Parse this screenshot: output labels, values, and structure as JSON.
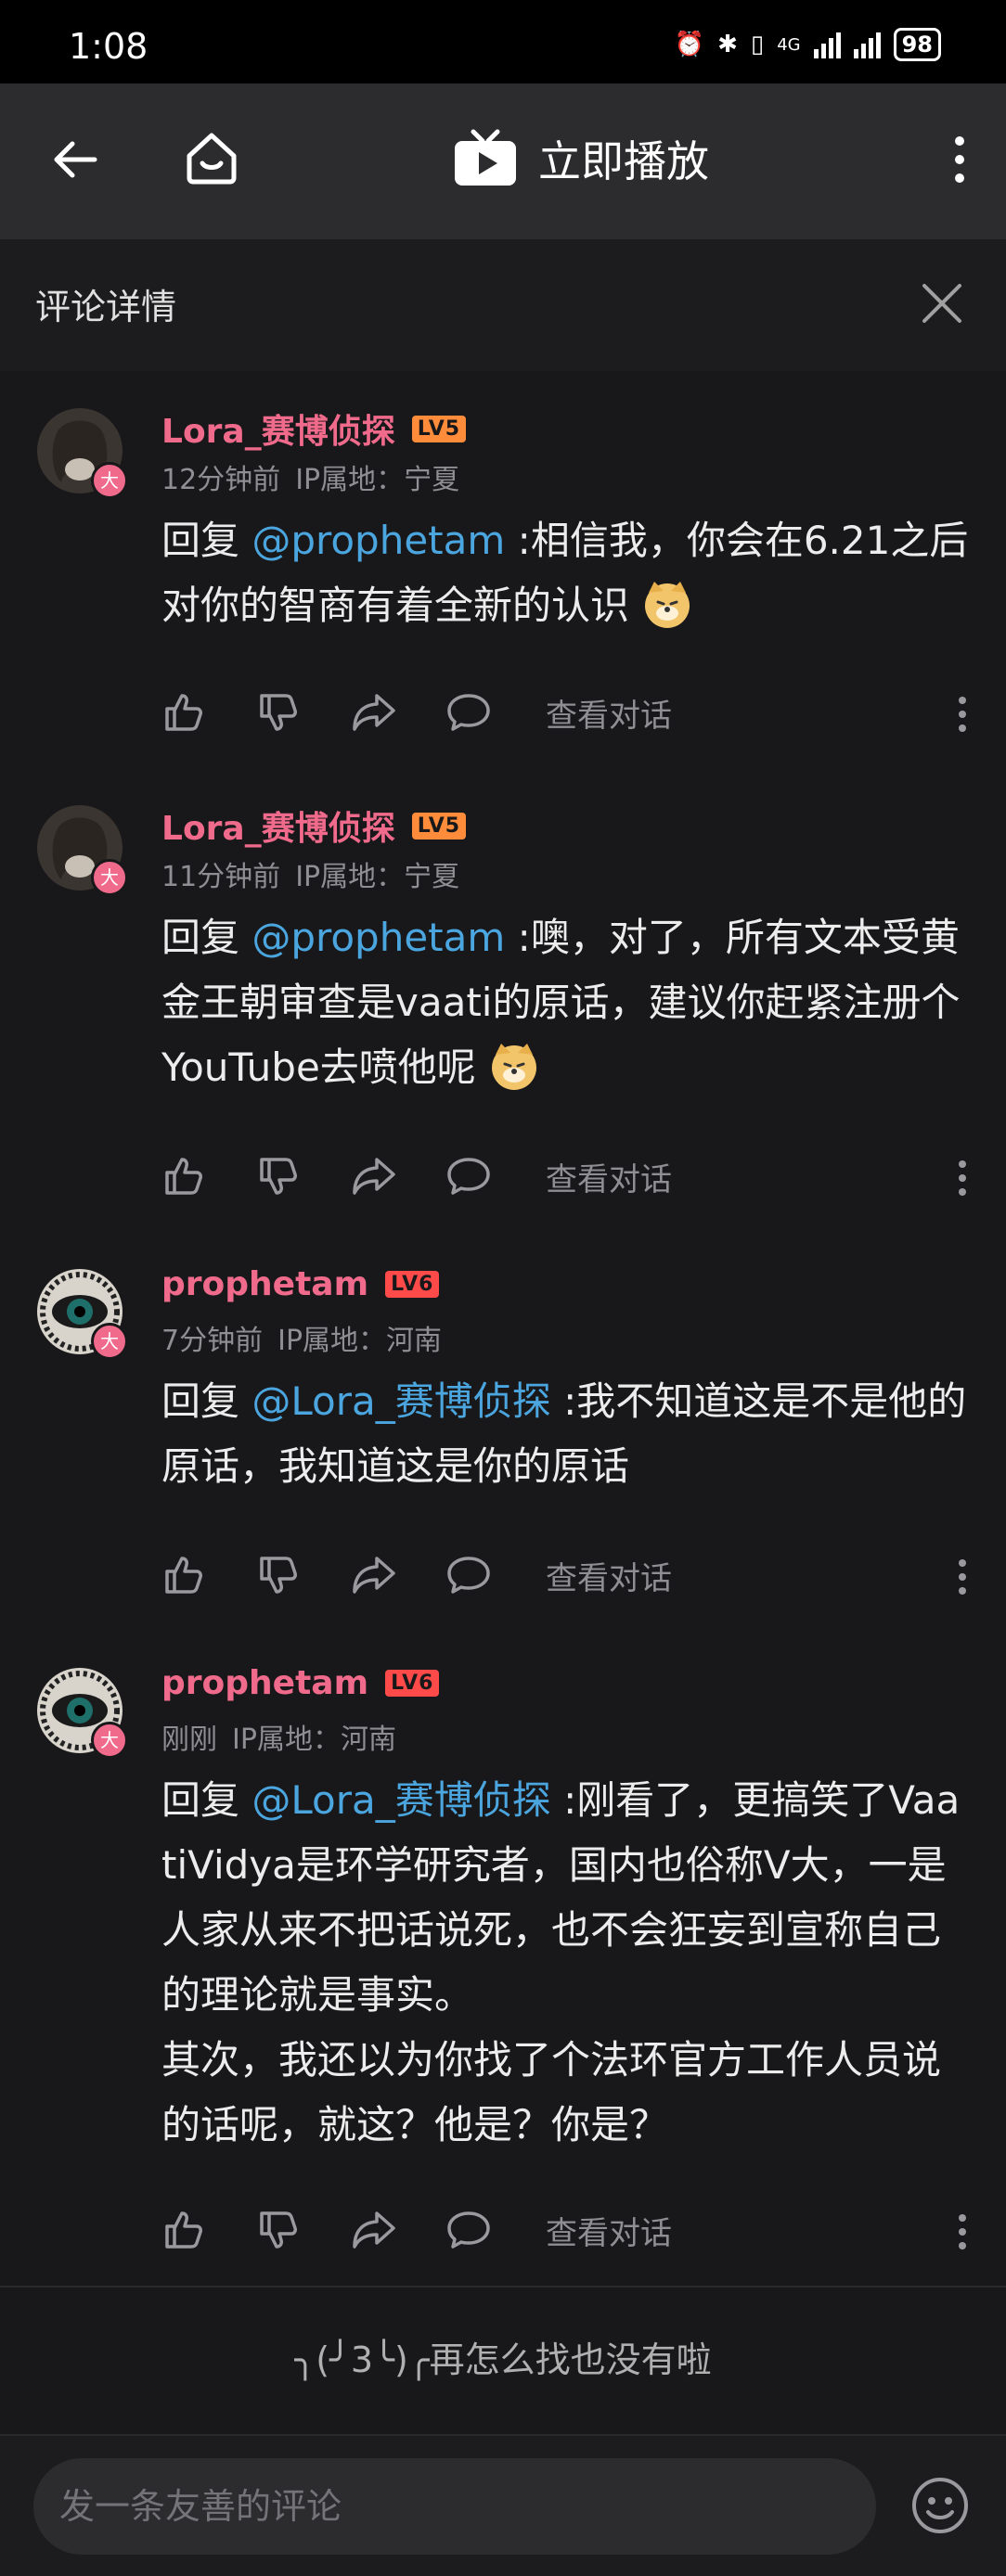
{
  "status_bar": {
    "time": "1:08",
    "battery": "98",
    "network": "4G"
  },
  "app_bar": {
    "play_label": "立即播放"
  },
  "panel": {
    "title": "评论详情"
  },
  "comments": [
    {
      "username": "Lora_赛博侦探",
      "level": "LV5",
      "time": "12分钟前",
      "ip": "IP属地：宁夏",
      "reply_prefix": "回复 ",
      "mention": "@prophetam",
      "text": " :相信我，你会在6.21之后对你的智商有着全新的认识",
      "view_label": "查看对话"
    },
    {
      "username": "Lora_赛博侦探",
      "level": "LV5",
      "time": "11分钟前",
      "ip": "IP属地：宁夏",
      "reply_prefix": "回复 ",
      "mention": "@prophetam",
      "text": " :噢，对了，所有文本受黄金王朝审查是vaati的原话，建议你赶紧注册个YouTube去喷他呢",
      "view_label": "查看对话"
    },
    {
      "username": "prophetam",
      "level": "LV6",
      "time": "7分钟前",
      "ip": "IP属地：河南",
      "reply_prefix": "回复 ",
      "mention": "@Lora_赛博侦探",
      "text": " :我不知道这是不是他的原话，我知道这是你的原话",
      "view_label": "查看对话"
    },
    {
      "username": "prophetam",
      "level": "LV6",
      "time": "刚刚",
      "ip": "IP属地：河南",
      "reply_prefix": "回复 ",
      "mention": "@Lora_赛博侦探",
      "text": " :刚看了，更搞笑了VaatiVidya是环学研究者，国内也俗称V大，一是人家从来不把话说死，也不会狂妄到宣称自己的理论就是事实。\n其次，我还以为你找了个法环官方工作人员说的话呢，就这？他是？你是？",
      "view_label": "查看对话"
    }
  ],
  "avatar_badge": "大",
  "footer": {
    "end_text": "╮(╯3╰)╭再怎么找也没有啦"
  },
  "input": {
    "placeholder": "发一条友善的评论"
  },
  "colors": {
    "accent_pink": "#f06a8c",
    "mention_blue": "#4ba6e0",
    "lv5": "#ff8c3a",
    "lv6": "#ff4a4a"
  }
}
